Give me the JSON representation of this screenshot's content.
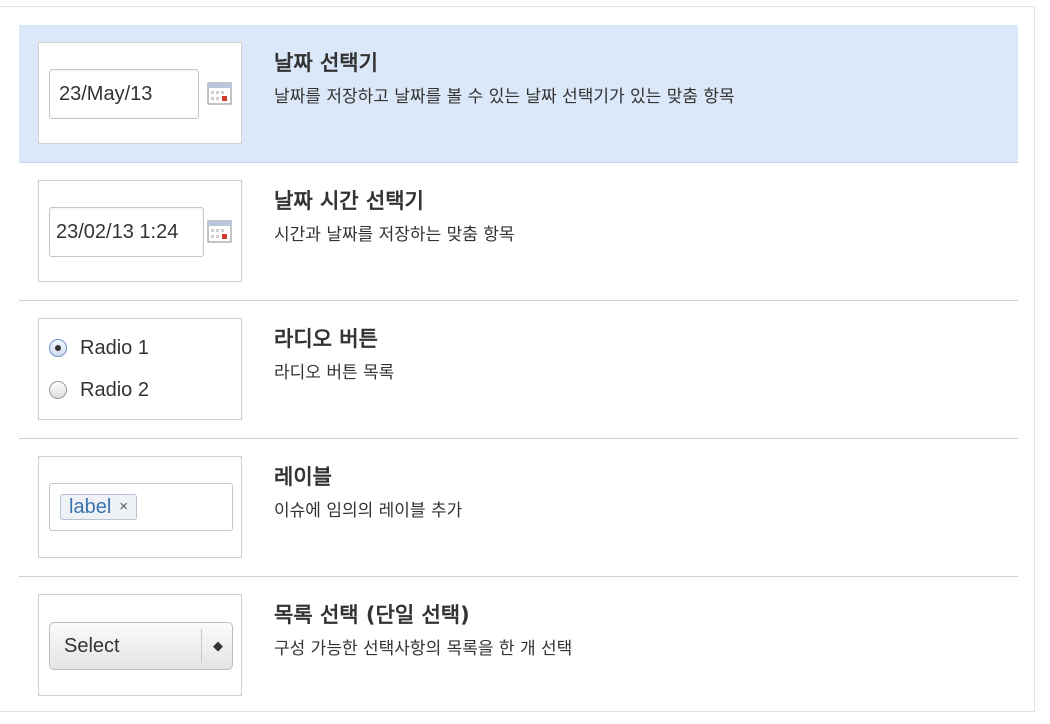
{
  "fields": [
    {
      "title": "날짜 선택기",
      "description": "날짜를 저장하고 날짜를 볼 수 있는 날짜 선택기가 있는 맞춤 항목",
      "preview_value": "23/May/13",
      "icon": "calendar-icon"
    },
    {
      "title": "날짜 시간 선택기",
      "description": "시간과 날짜를 저장하는 맞춤 항목",
      "preview_value": "23/02/13 1:24",
      "icon": "calendar-icon"
    },
    {
      "title": "라디오 버튼",
      "description": "라디오 버튼 목록",
      "options": [
        "Radio 1",
        "Radio 2"
      ],
      "selected": "Radio 1"
    },
    {
      "title": "레이블",
      "description": "이슈에 임의의 레이블 추가",
      "label": "label",
      "remove_glyph": "×"
    },
    {
      "title": "목록 선택 (단일 선택)",
      "description": "구성 가능한 선택사항의 목록을 한 개 선택",
      "select_value": "Select",
      "select_arrows": "◆"
    }
  ],
  "colors": {
    "selected_row_bg": "#dbe8f9",
    "label_text": "#3b73af"
  }
}
